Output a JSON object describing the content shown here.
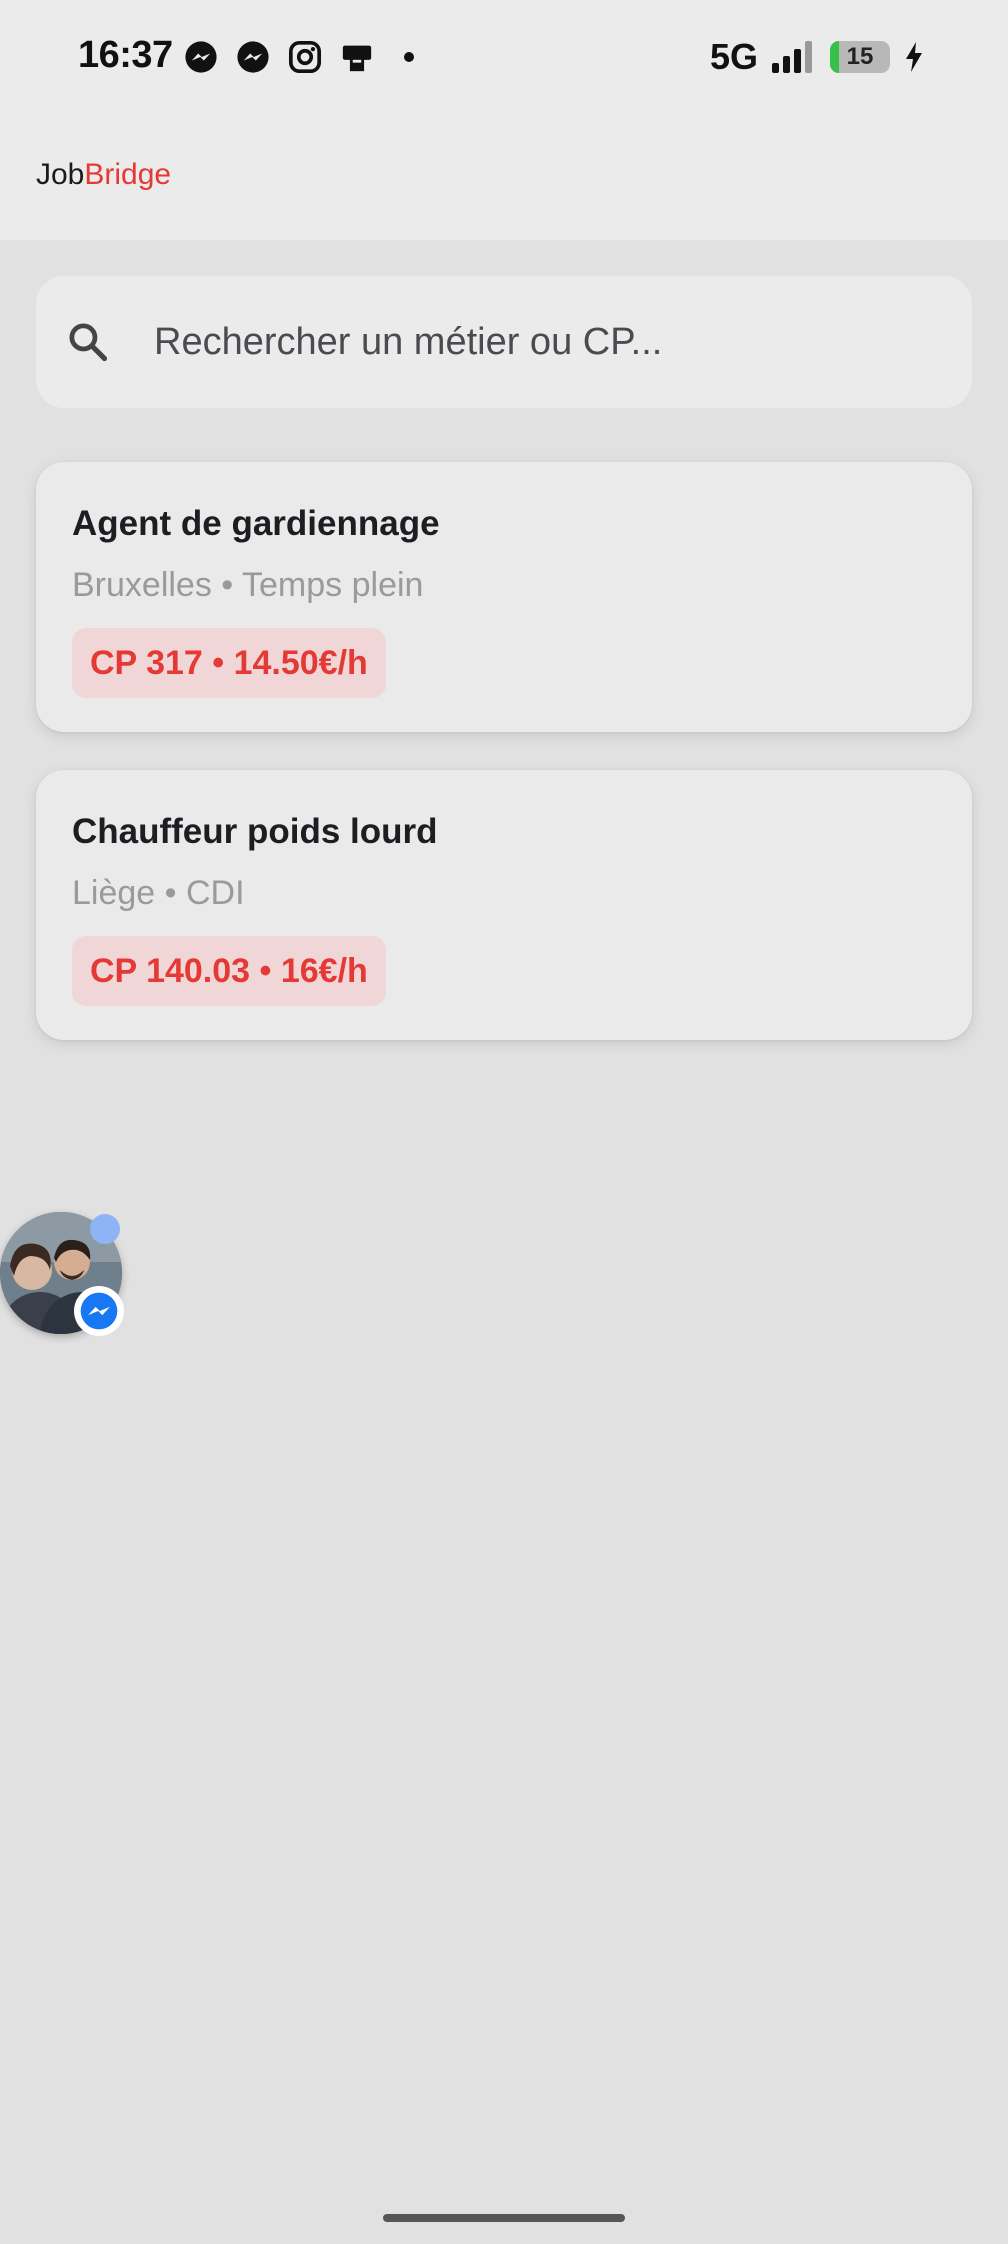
{
  "status_bar": {
    "time": "16:37",
    "notification_icons": [
      "messenger-icon",
      "messenger-icon",
      "instagram-icon",
      "printer-icon"
    ],
    "network": "5G",
    "battery_level": "15",
    "battery_fraction": 0.15,
    "charging": true
  },
  "app_bar": {
    "brand_part1": "Job",
    "brand_part2": "Bridge"
  },
  "search": {
    "placeholder": "Rechercher un métier ou CP..."
  },
  "jobs": [
    {
      "title": "Agent de gardiennage",
      "meta": "Bruxelles • Temps plein",
      "badge": "CP 317 • 14.50€/h"
    },
    {
      "title": "Chauffeur poids lourd",
      "meta": "Liège • CDI",
      "badge": "CP 140.03 • 16€/h"
    }
  ],
  "colors": {
    "accent": "#e53935",
    "badge_bg": "#f0d6d6",
    "page_bg": "#e1e1e1",
    "card_bg": "#eaeaea",
    "messenger": "#1877f2"
  }
}
